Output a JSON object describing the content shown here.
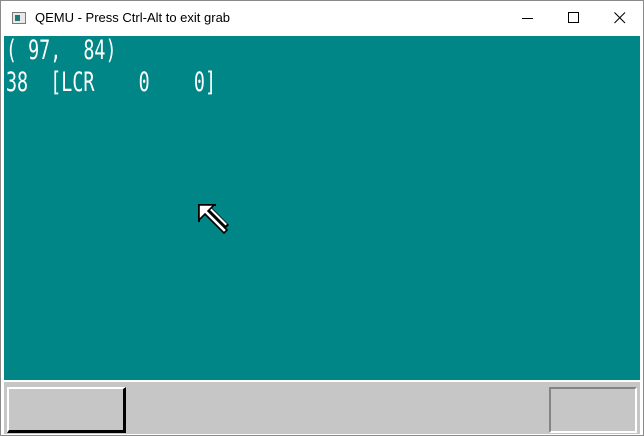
{
  "window": {
    "title": "QEMU - Press Ctrl-Alt to exit grab",
    "icon": "qemu-app-icon",
    "controls": {
      "minimize_icon": "minimize-icon",
      "maximize_icon": "maximize-icon",
      "close_icon": "close-icon"
    }
  },
  "screen": {
    "background_color": "#008686",
    "text_color": "#ffffff",
    "lines": [
      "( 97,  84)",
      "38  [LCR    0    0]"
    ],
    "cursor_icon": "mouse-arrow-icon"
  },
  "taskbar": {
    "background_color": "#c6c6c6",
    "left_button_label": "",
    "right_box_label": ""
  }
}
